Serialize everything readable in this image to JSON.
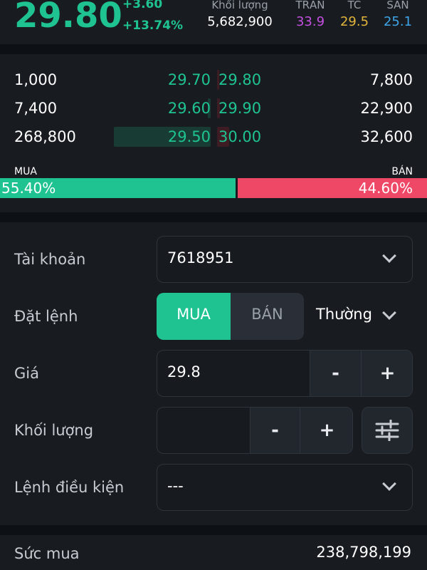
{
  "quote": {
    "price": "29.80",
    "change": "+3.60",
    "change_pct": "+13.74%",
    "volume_label": "Khối lượng",
    "volume": "5,682,900",
    "ceiling_label": "TRẦN",
    "ceiling": "33.9",
    "reference_label": "TC",
    "reference": "29.5",
    "floor_label": "SÀN",
    "floor": "25.1"
  },
  "orderbook": {
    "rows": [
      {
        "bid_vol": "1,000",
        "bid_price": "29.70",
        "ask_price": "29.80",
        "ask_vol": "7,800",
        "bid_bar": 0.0,
        "ask_bar": 0.02
      },
      {
        "bid_vol": "7,400",
        "bid_price": "29.60",
        "ask_price": "29.90",
        "ask_vol": "22,900",
        "bid_bar": 0.03,
        "ask_bar": 0.03
      },
      {
        "bid_vol": "268,800",
        "bid_price": "29.50",
        "ask_price": "30.00",
        "ask_vol": "32,600",
        "bid_bar": 1.0,
        "ask_bar": 0.12
      }
    ],
    "buy_label": "MUA",
    "sell_label": "BÁN",
    "buy_ratio": "55.40%",
    "sell_ratio": "44.60%"
  },
  "form": {
    "account_label": "Tài khoản",
    "account_value": "7618951",
    "order_label": "Đặt lệnh",
    "buy_btn": "MUA",
    "sell_btn": "BÁN",
    "order_type": "Thường",
    "price_label": "Giá",
    "price_value": "29.8",
    "qty_label": "Khối lượng",
    "qty_value": "",
    "minus": "-",
    "plus": "+",
    "cond_label": "Lệnh điều kiện",
    "cond_value": "---"
  },
  "footer": {
    "buying_power_label": "Sức mua",
    "buying_power": "238,798,199"
  },
  "colors": {
    "up": "#1fc391",
    "down": "#ef4766",
    "ceiling": "#c44fe0",
    "reference": "#e3b53b",
    "floor": "#3da5e8"
  }
}
